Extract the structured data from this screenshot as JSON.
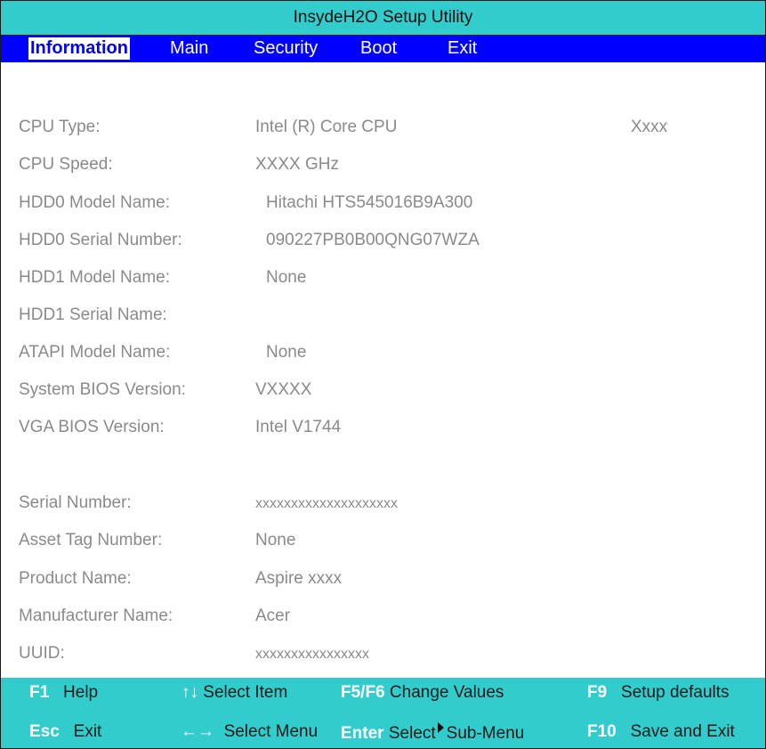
{
  "title": "InsydeH2O Setup Utility",
  "menu": [
    {
      "label": "Information",
      "active": true
    },
    {
      "label": "Main"
    },
    {
      "label": "Security"
    },
    {
      "label": "Boot"
    },
    {
      "label": "Exit"
    }
  ],
  "info": {
    "cpu_type": {
      "label": "CPU Type:",
      "value": "Intel (R) Core CPU",
      "extra": "Xxxx"
    },
    "cpu_speed": {
      "label": "CPU Speed:",
      "value": "XXXX GHz"
    },
    "hdd0_model": {
      "label": "HDD0 Model Name:",
      "value": "Hitachi HTS545016B9A300"
    },
    "hdd0_serial": {
      "label": "HDD0 Serial Number:",
      "value": "090227PB0B00QNG07WZA"
    },
    "hdd1_model": {
      "label": "HDD1 Model Name:",
      "value": "None"
    },
    "hdd1_serial": {
      "label": "HDD1 Serial Name:",
      "value": ""
    },
    "atapi_model": {
      "label": "ATAPI Model Name:",
      "value": "None"
    },
    "sys_bios": {
      "label": "System BIOS Version:",
      "value": "VXXXX"
    },
    "vga_bios": {
      "label": "VGA BIOS Version:",
      "value": "Intel V1744"
    },
    "serial_number": {
      "label": "Serial Number:",
      "value": "xxxxxxxxxxxxxxxxxxxx"
    },
    "asset_tag": {
      "label": "Asset Tag Number:",
      "value": "None"
    },
    "product_name": {
      "label": "Product Name:",
      "value": "Aspire xxxx"
    },
    "manufacturer": {
      "label": "Manufacturer Name:",
      "value": "Acer"
    },
    "uuid": {
      "label": "UUID:",
      "value": "xxxxxxxxxxxxxxxx"
    }
  },
  "footer": {
    "f1": {
      "key": "F1",
      "text": "Help"
    },
    "updown": {
      "arrows": "↑↓",
      "text": "Select Item"
    },
    "f5f6": {
      "key": "F5/F6",
      "text": "Change Values"
    },
    "f9": {
      "key": "F9",
      "text": "Setup defaults"
    },
    "esc": {
      "key": "Esc",
      "text": "Exit"
    },
    "leftright": {
      "arrows": "←→",
      "text": "Select Menu"
    },
    "enter": {
      "key": "Enter",
      "text_a": "Select",
      "text_b": "Sub-Menu"
    },
    "f10": {
      "key": "F10",
      "text": "Save and Exit"
    }
  },
  "colors": {
    "title_bar": "#33cccc",
    "menu_bar": "#0000ff",
    "label_text": "#8a8a8a",
    "key_text": "#ffffff"
  }
}
